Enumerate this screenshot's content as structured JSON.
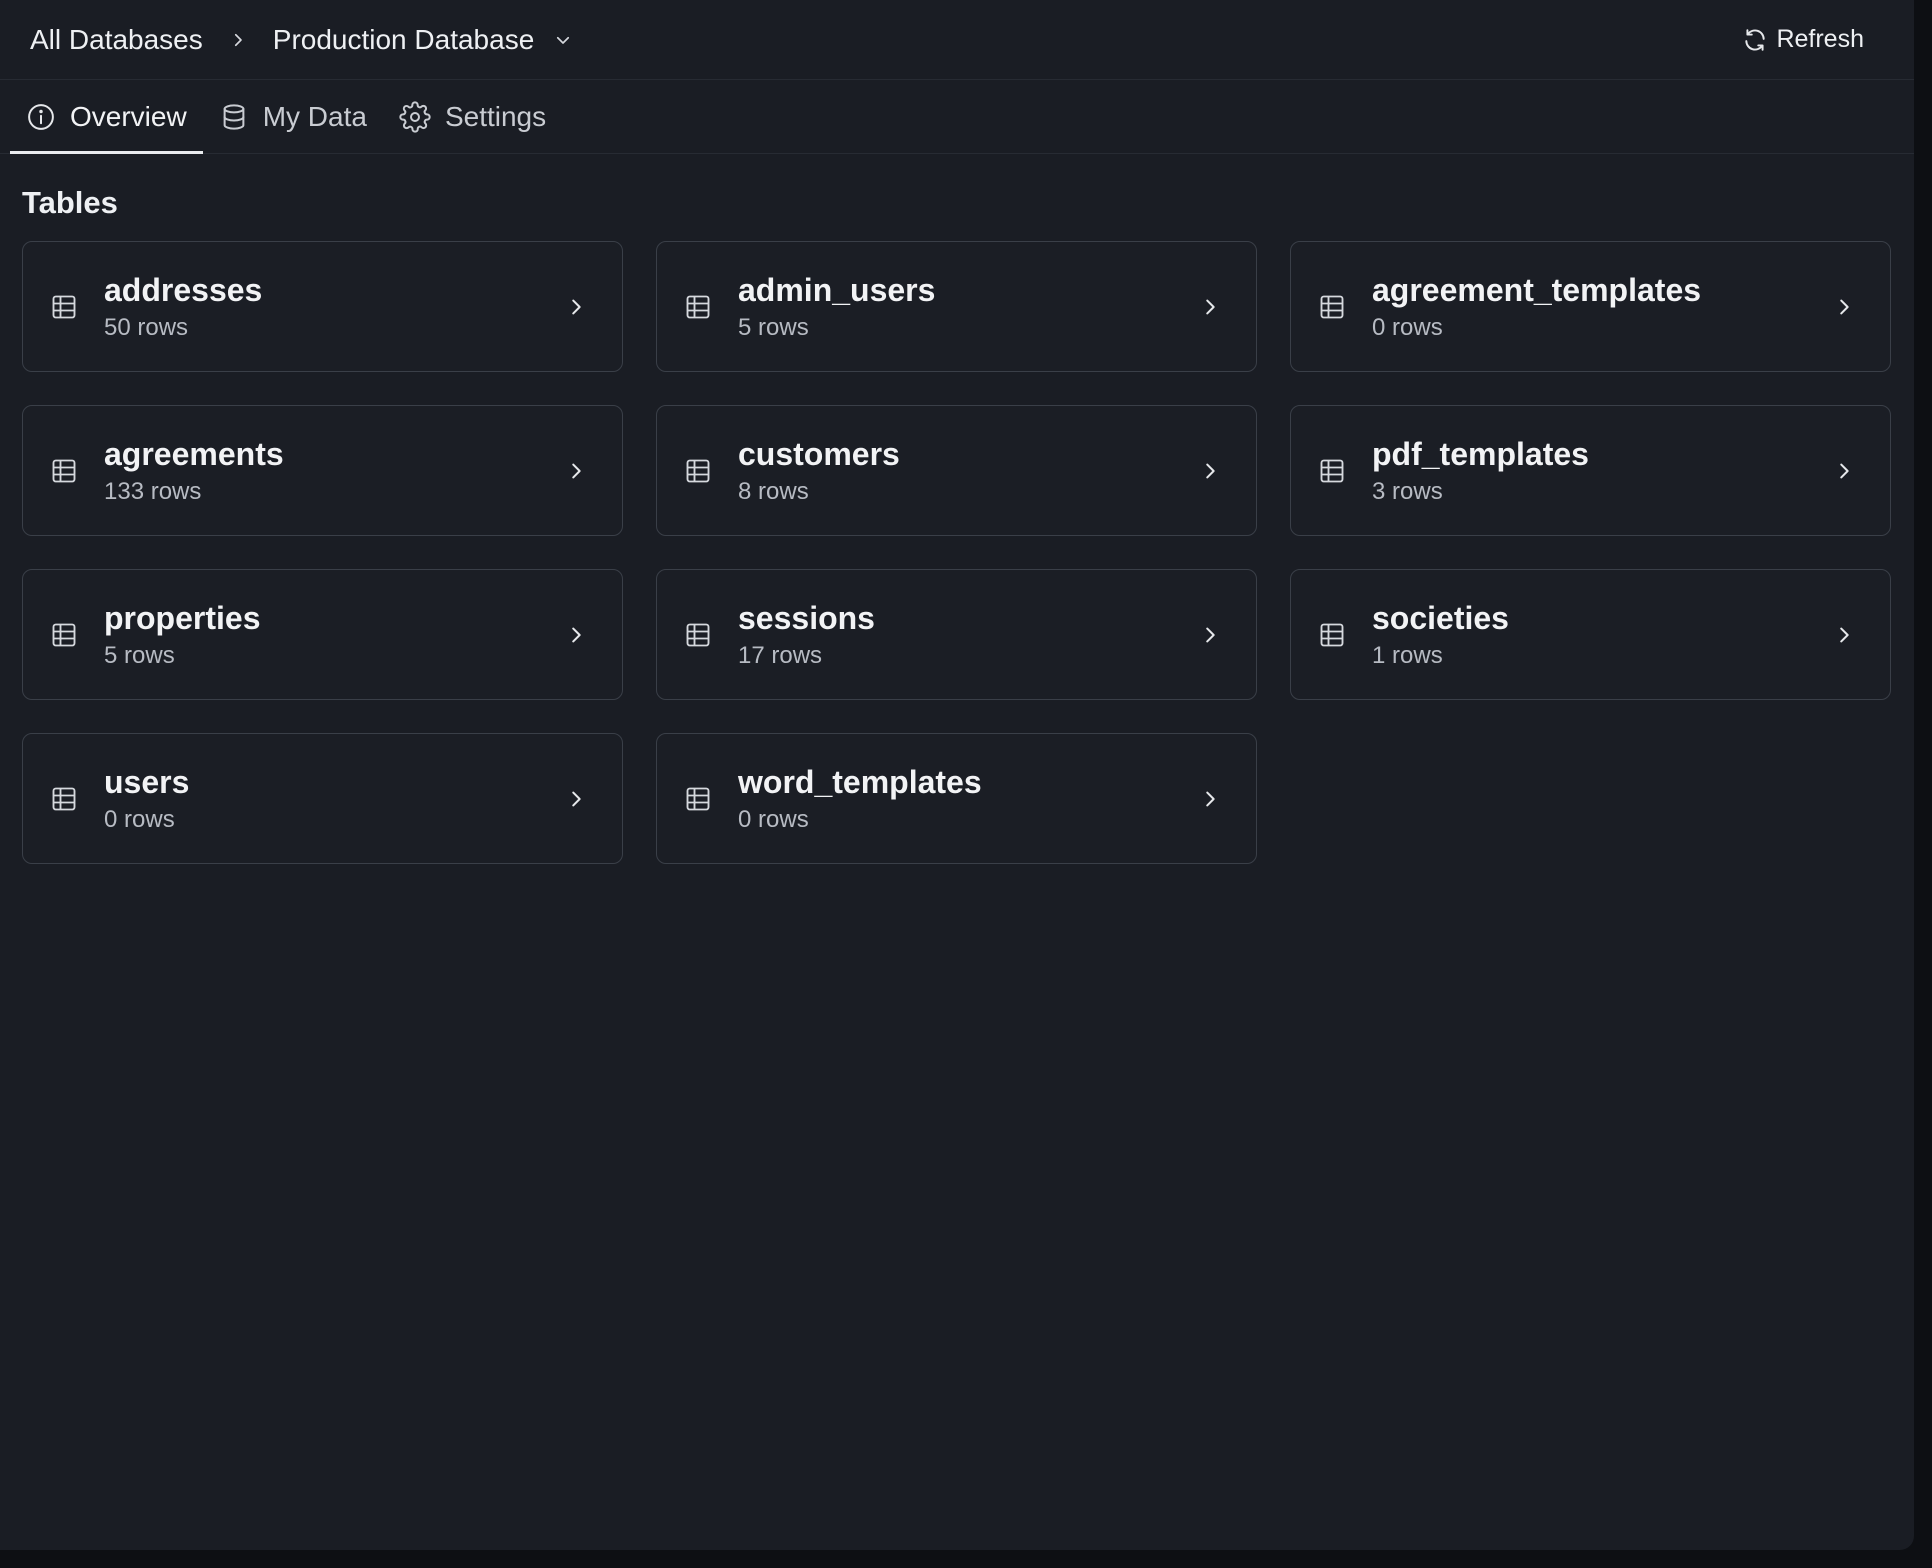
{
  "colors": {
    "background": "#1a1d24",
    "card_border": "#3a3f48",
    "text_primary": "#f2f3f5",
    "text_secondary": "#b7bbc3"
  },
  "header": {
    "breadcrumb_root": "All Databases",
    "breadcrumb_sep_icon": "chevron-right-icon",
    "breadcrumb_current": "Production Database",
    "breadcrumb_dropdown_icon": "chevron-down-icon",
    "refresh_icon": "refresh-icon",
    "refresh_label": "Refresh"
  },
  "tabs": [
    {
      "label": "Overview",
      "icon": "info-icon",
      "active": true
    },
    {
      "label": "My Data",
      "icon": "database-icon",
      "active": false
    },
    {
      "label": "Settings",
      "icon": "gear-icon",
      "active": false
    }
  ],
  "main": {
    "section_title": "Tables",
    "tables": [
      {
        "name": "addresses",
        "rows": "50 rows"
      },
      {
        "name": "admin_users",
        "rows": "5 rows"
      },
      {
        "name": "agreement_templates",
        "rows": "0 rows"
      },
      {
        "name": "agreements",
        "rows": "133 rows"
      },
      {
        "name": "customers",
        "rows": "8 rows"
      },
      {
        "name": "pdf_templates",
        "rows": "3 rows"
      },
      {
        "name": "properties",
        "rows": "5 rows"
      },
      {
        "name": "sessions",
        "rows": "17 rows"
      },
      {
        "name": "societies",
        "rows": "1 rows"
      },
      {
        "name": "users",
        "rows": "0 rows"
      },
      {
        "name": "word_templates",
        "rows": "0 rows"
      }
    ]
  }
}
